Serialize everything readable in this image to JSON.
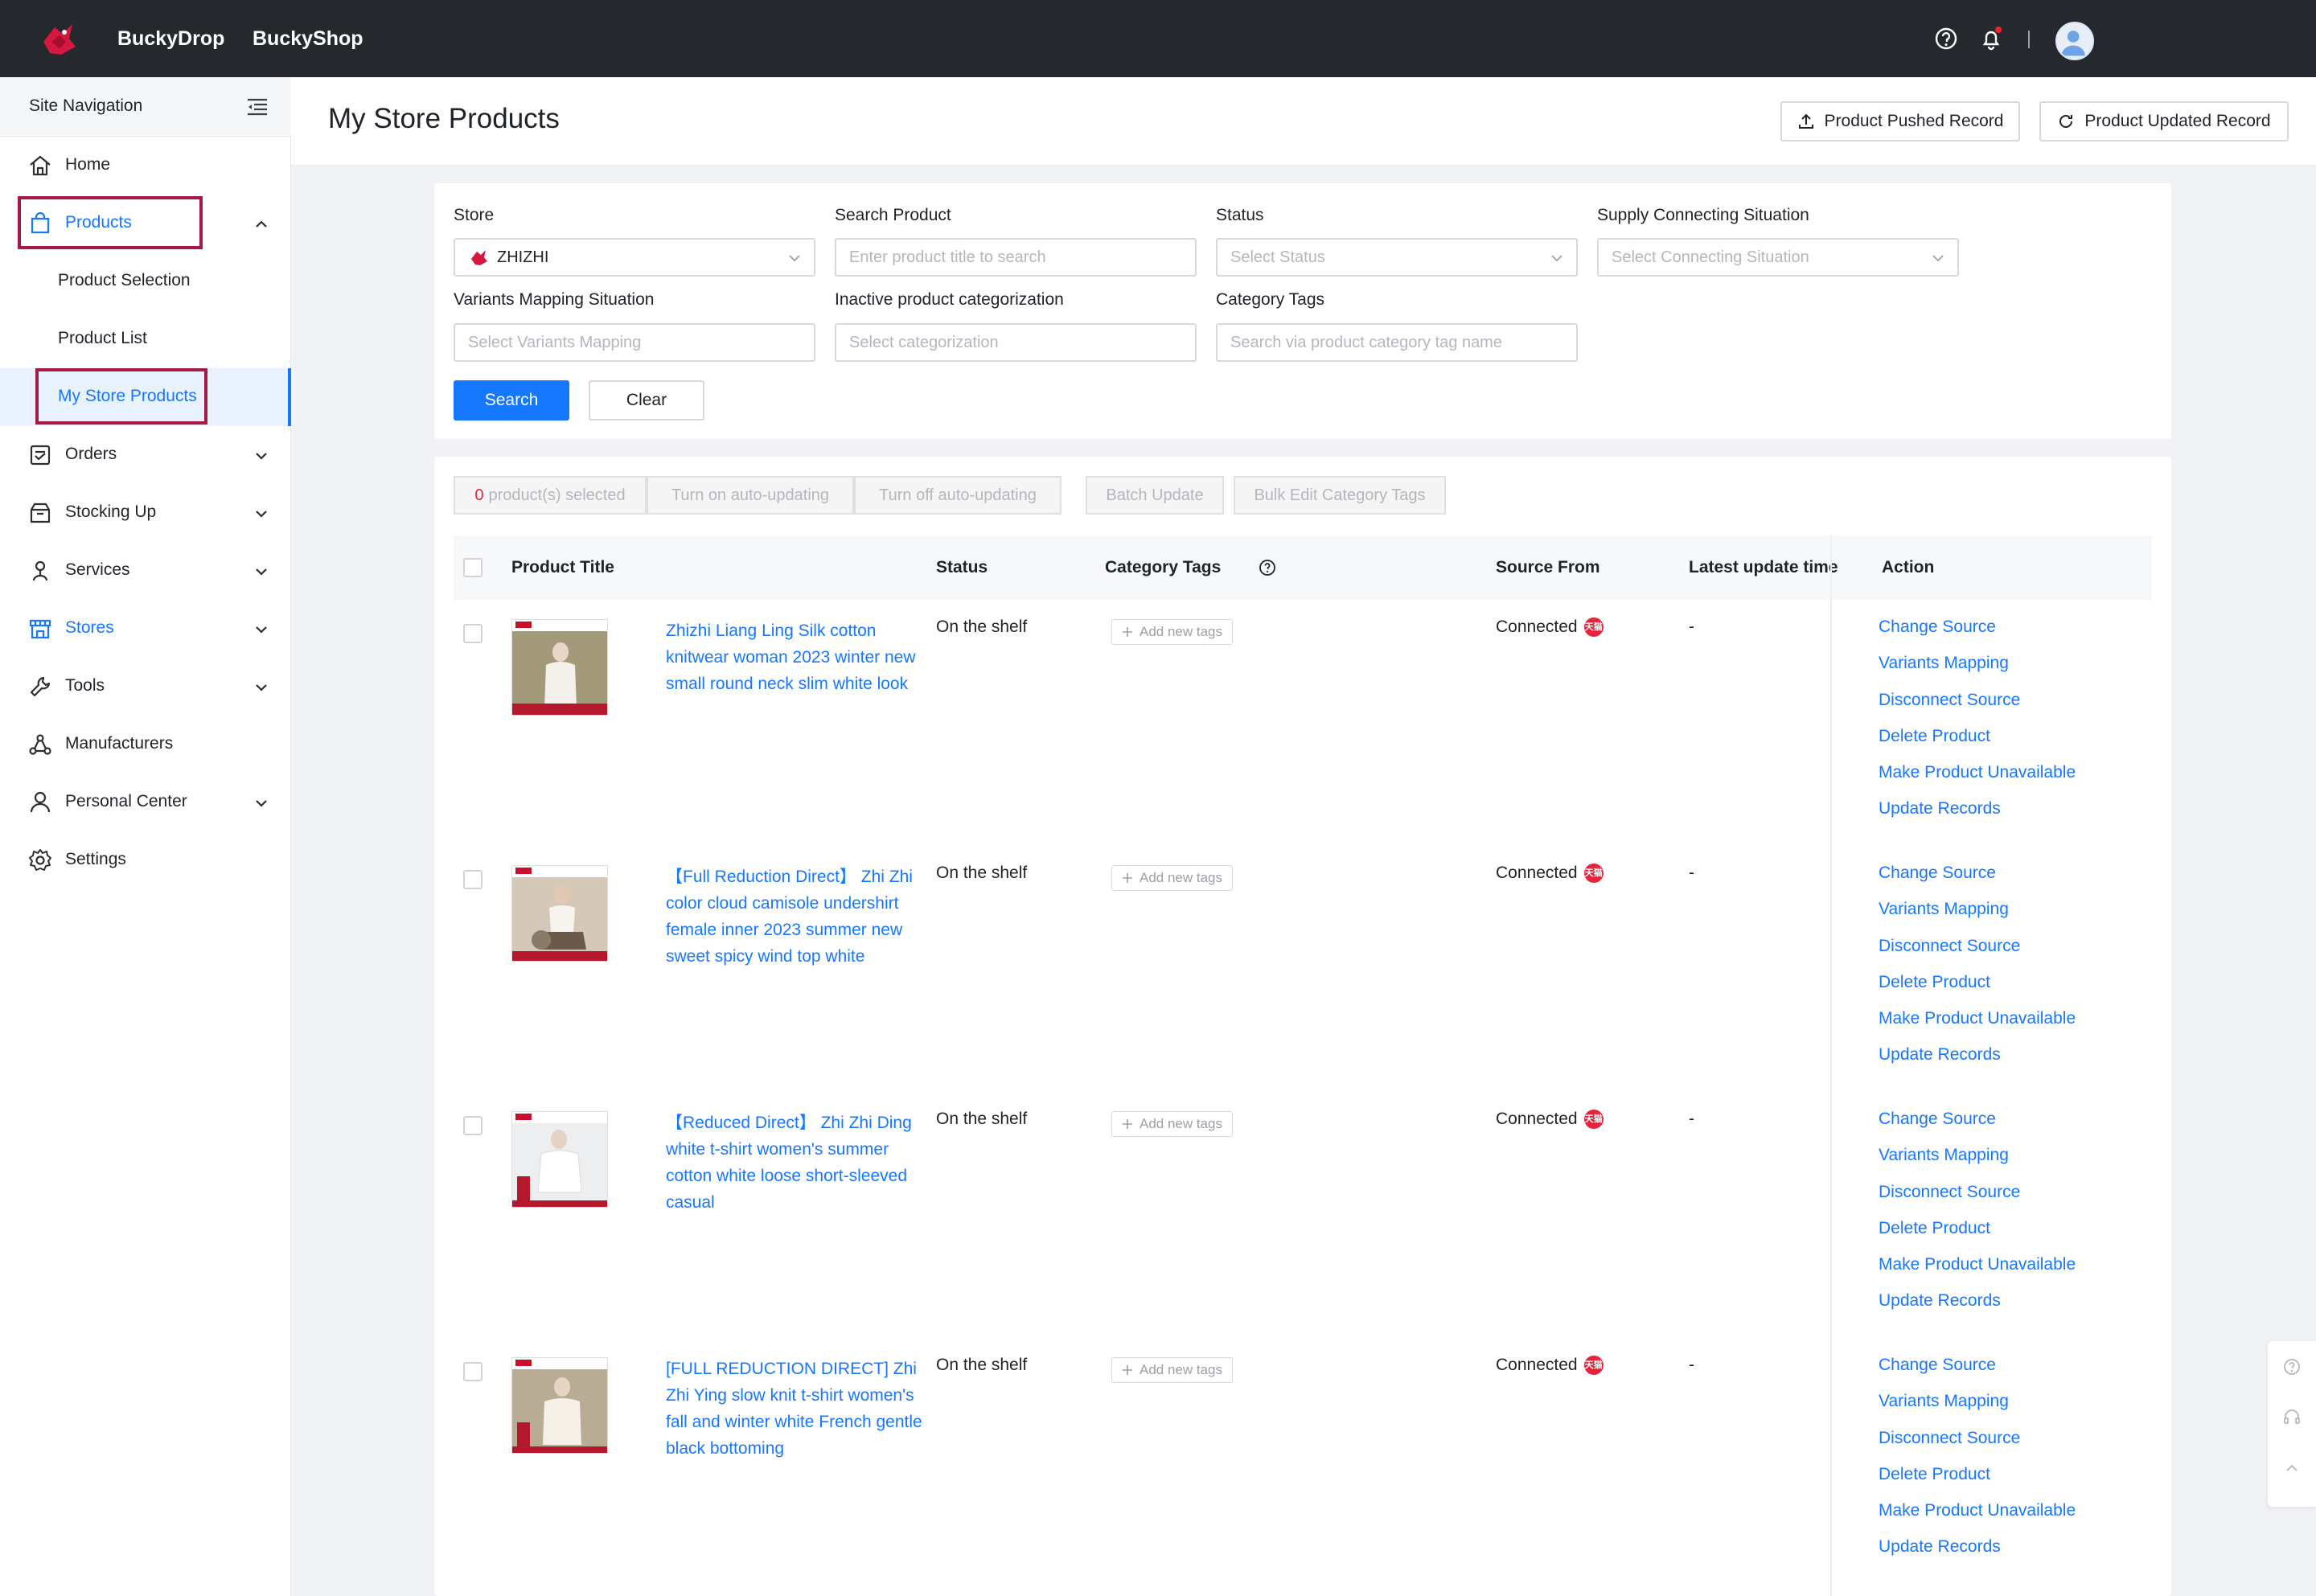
{
  "topbar": {
    "brand_primary": "BuckyDrop",
    "brand_secondary": "BuckyShop"
  },
  "sidebar": {
    "header": "Site Navigation",
    "items": [
      {
        "label": "Home",
        "icon": "home-icon"
      },
      {
        "label": "Products",
        "icon": "shopping-bag-icon",
        "expanded": true,
        "children": [
          "Product Selection",
          "Product List",
          "My Store Products"
        ]
      },
      {
        "label": "Orders",
        "icon": "orders-icon"
      },
      {
        "label": "Stocking Up",
        "icon": "box-icon"
      },
      {
        "label": "Services",
        "icon": "services-icon"
      },
      {
        "label": "Stores",
        "icon": "store-icon"
      },
      {
        "label": "Tools",
        "icon": "wrench-icon"
      },
      {
        "label": "Manufacturers",
        "icon": "network-icon"
      },
      {
        "label": "Personal Center",
        "icon": "user-icon"
      },
      {
        "label": "Settings",
        "icon": "gear-icon"
      }
    ]
  },
  "header": {
    "title": "My Store Products",
    "pushed_record": "Product Pushed Record",
    "updated_record": "Product Updated Record"
  },
  "filters": {
    "store": {
      "label": "Store",
      "value": "ZHIZHI"
    },
    "search_product": {
      "label": "Search Product",
      "placeholder": "Enter product title to search"
    },
    "status": {
      "label": "Status",
      "placeholder": "Select Status"
    },
    "supply": {
      "label": "Supply Connecting Situation",
      "placeholder": "Select Connecting Situation"
    },
    "variants": {
      "label": "Variants Mapping Situation",
      "placeholder": "Select Variants Mapping"
    },
    "inactive": {
      "label": "Inactive product categorization",
      "placeholder": "Select categorization"
    },
    "category_tags": {
      "label": "Category Tags",
      "placeholder": "Search via product category tag name"
    },
    "search_btn": "Search",
    "clear_btn": "Clear"
  },
  "bulk": {
    "selected_count": "0",
    "selected_suffix": "product(s) selected",
    "auto_on": "Turn on auto-updating",
    "auto_off": "Turn off auto-updating",
    "batch_update": "Batch Update",
    "bulk_edit_tags": "Bulk Edit Category Tags"
  },
  "table": {
    "columns": {
      "title": "Product Title",
      "status": "Status",
      "tags": "Category Tags",
      "source": "Source From",
      "latest": "Latest update time",
      "action": "Action"
    },
    "add_tag_label": "Add new tags",
    "source_badge": "天猫",
    "actions": [
      "Change Source",
      "Variants Mapping",
      "Disconnect Source",
      "Delete Product",
      "Make Product Unavailable",
      "Update Records"
    ],
    "rows": [
      {
        "title": "Zhizhi Liang Ling Silk cotton knitwear woman 2023 winter new small round neck slim white look",
        "status": "On the shelf",
        "source": "Connected",
        "latest": "-"
      },
      {
        "title": "【Full Reduction Direct】 Zhi Zhi color cloud camisole undershirt female inner 2023 summer new sweet spicy wind top white",
        "status": "On the shelf",
        "source": "Connected",
        "latest": "-"
      },
      {
        "title": "【Reduced Direct】 Zhi Zhi Ding white t-shirt women's summer cotton white loose short-sleeved casual",
        "status": "On the shelf",
        "source": "Connected",
        "latest": "-"
      },
      {
        "title": "[FULL REDUCTION DIRECT] Zhi Zhi Ying slow knit t-shirt women's fall and winter white French gentle black bottoming",
        "status": "On the shelf",
        "source": "Connected",
        "latest": "-"
      }
    ]
  },
  "colors": {
    "accent": "#1677ff",
    "topbar": "#25282d",
    "highlight_box": "#a51b46",
    "badge_red": "#e5243b"
  }
}
